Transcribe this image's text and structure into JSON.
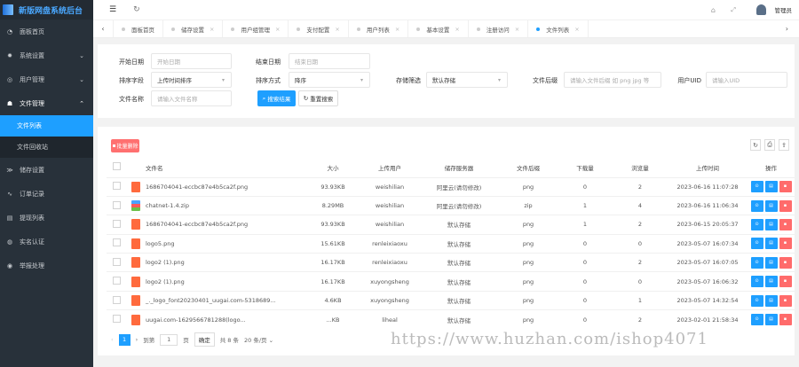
{
  "app_title": "新版网盘系统后台",
  "sidebar": {
    "items": [
      {
        "label": "面板首页",
        "icon": "dashboard-icon"
      },
      {
        "label": "系统设置",
        "icon": "settings-icon",
        "chevron": "⌄"
      },
      {
        "label": "用户管理",
        "icon": "user-icon",
        "chevron": "⌄"
      },
      {
        "label": "文件管理",
        "icon": "file-icon",
        "chevron": "⌃"
      },
      {
        "label": "储存设置",
        "icon": "storage-icon"
      },
      {
        "label": "订单记录",
        "icon": "order-icon"
      },
      {
        "label": "提现列表",
        "icon": "withdraw-icon"
      },
      {
        "label": "实名认证",
        "icon": "verify-icon"
      },
      {
        "label": "举报处理",
        "icon": "report-icon"
      }
    ],
    "sub_items": [
      {
        "label": "文件列表"
      },
      {
        "label": "文件回收站"
      }
    ]
  },
  "header": {
    "user": "管理员"
  },
  "tabs": [
    {
      "label": "面板首页"
    },
    {
      "label": "储存设置"
    },
    {
      "label": "用户组管理"
    },
    {
      "label": "支付配置"
    },
    {
      "label": "用户列表"
    },
    {
      "label": "基本设置"
    },
    {
      "label": "注册访问"
    },
    {
      "label": "文件列表"
    }
  ],
  "search": {
    "start_date": {
      "label": "开始日期",
      "placeholder": "开始日期"
    },
    "end_date": {
      "label": "结束日期",
      "placeholder": "结束日期"
    },
    "sort_field": {
      "label": "排序字段",
      "value": "上传时间排序"
    },
    "sort_order": {
      "label": "排序方式",
      "value": "降序"
    },
    "storage": {
      "label": "存储筛选",
      "value": "默认存储"
    },
    "suffix": {
      "label": "文件后缀",
      "placeholder": "请输入文件后缀 如 png jpg 等"
    },
    "uid": {
      "label": "用户UID",
      "placeholder": "请输入UID"
    },
    "filename": {
      "label": "文件名称",
      "placeholder": "请输入文件名称"
    },
    "search_btn": "搜索结果",
    "reset_btn": "重置搜索"
  },
  "toolbar": {
    "batch_delete": "批量删除"
  },
  "table": {
    "headers": [
      "文件名",
      "大小",
      "上传用户",
      "储存服务器",
      "文件后缀",
      "下载量",
      "浏览量",
      "上传时间",
      "操作"
    ],
    "rows": [
      [
        "1686704041-eccbc87e4b5ca2f.png",
        "93.93KB",
        "weishilian",
        "阿里云(请勿修改)",
        "png",
        "0",
        "2",
        "2023-06-16 11:07:28"
      ],
      [
        "chatnet-1.4.zip",
        "8.29MB",
        "weishilian",
        "阿里云(请勿修改)",
        "zip",
        "1",
        "4",
        "2023-06-16 11:06:34"
      ],
      [
        "1686704041-eccbc87e4b5ca2f.png",
        "93.93KB",
        "weishilian",
        "默认存储",
        "png",
        "1",
        "2",
        "2023-06-15 20:05:37"
      ],
      [
        "logo5.png",
        "15.61KB",
        "renleixiaoxu",
        "默认存储",
        "png",
        "0",
        "0",
        "2023-05-07 16:07:34"
      ],
      [
        "logo2 (1).png",
        "16.17KB",
        "renleixiaoxu",
        "默认存储",
        "png",
        "0",
        "2",
        "2023-05-07 16:07:05"
      ],
      [
        "logo2 (1).png",
        "16.17KB",
        "xuyongsheng",
        "默认存储",
        "png",
        "0",
        "0",
        "2023-05-07 16:06:32"
      ],
      [
        "_._logo_font20230401_uugai.com-5318689...",
        "4.6KB",
        "xuyongsheng",
        "默认存储",
        "png",
        "0",
        "1",
        "2023-05-07 14:32:54"
      ],
      [
        "uugai.com-1629566781288(logo...",
        "...KB",
        "liheal",
        "默认存储",
        "png",
        "0",
        "2",
        "2023-02-01 21:58:34"
      ]
    ]
  },
  "pagination": {
    "current": "1",
    "goto_label": "到第",
    "goto_value": "1",
    "page_unit": "页",
    "confirm": "确定",
    "total": "共 8 条",
    "page_size": "20 条/页"
  },
  "watermark": "https://www.huzhan.com/ishop4071",
  "colors": {
    "sidebar": "#28313a",
    "accent": "#1e9fff",
    "danger": "#ff6b6b",
    "file_icon": "#ff6a3d"
  }
}
